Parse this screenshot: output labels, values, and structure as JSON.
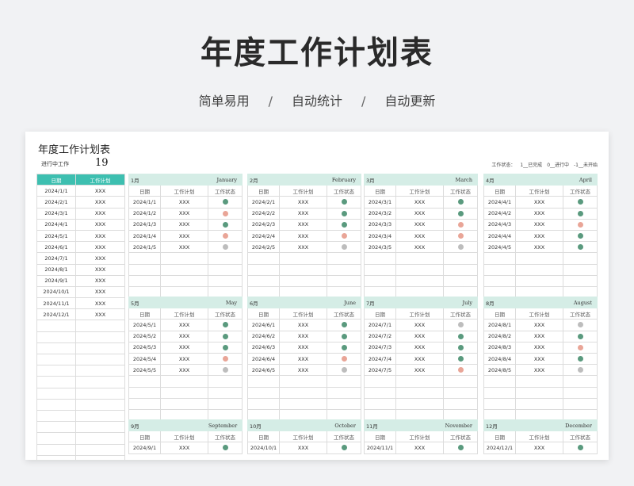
{
  "hero": {
    "title": "年度工作计划表",
    "sub1": "简单易用",
    "sub2": "自动统计",
    "sub3": "自动更新",
    "sep": "/"
  },
  "sheet": {
    "title": "年度工作计划表",
    "inprogress_label": "进行中工作",
    "inprogress_value": "19",
    "legend": {
      "label": "工作状态：",
      "done": "1__已完成",
      "doing": "0__进行中",
      "todo": "-1__未开始"
    }
  },
  "colors": {
    "done": "#5a9a7e",
    "doing": "#e9a597",
    "todo": "#bdbdbd",
    "accent": "#3dbfb0",
    "month_header": "#d5ede6"
  },
  "summary": {
    "headers": [
      "日期",
      "工作计划"
    ],
    "rows": [
      [
        "2024/1/1",
        "XXX"
      ],
      [
        "2024/2/1",
        "XXX"
      ],
      [
        "2024/3/1",
        "XXX"
      ],
      [
        "2024/4/1",
        "XXX"
      ],
      [
        "2024/5/1",
        "XXX"
      ],
      [
        "2024/6/1",
        "XXX"
      ],
      [
        "2024/7/1",
        "XXX"
      ],
      [
        "2024/8/1",
        "XXX"
      ],
      [
        "2024/9/1",
        "XXX"
      ],
      [
        "2024/10/1",
        "XXX"
      ],
      [
        "2024/11/1",
        "XXX"
      ],
      [
        "2024/12/1",
        "XXX"
      ]
    ]
  },
  "month_columns": [
    "日期",
    "工作计划",
    "工作状态"
  ],
  "months": [
    {
      "name": "1月",
      "en": "January",
      "rows": [
        [
          "2024/1/1",
          "XXX",
          "done"
        ],
        [
          "2024/1/2",
          "XXX",
          "doing"
        ],
        [
          "2024/1/3",
          "XXX",
          "done"
        ],
        [
          "2024/1/4",
          "XXX",
          "doing"
        ],
        [
          "2024/1/5",
          "XXX",
          "todo"
        ]
      ]
    },
    {
      "name": "2月",
      "en": "February",
      "rows": [
        [
          "2024/2/1",
          "XXX",
          "done"
        ],
        [
          "2024/2/2",
          "XXX",
          "done"
        ],
        [
          "2024/2/3",
          "XXX",
          "done"
        ],
        [
          "2024/2/4",
          "XXX",
          "doing"
        ],
        [
          "2024/2/5",
          "XXX",
          "todo"
        ]
      ]
    },
    {
      "name": "3月",
      "en": "March",
      "rows": [
        [
          "2024/3/1",
          "XXX",
          "done"
        ],
        [
          "2024/3/2",
          "XXX",
          "done"
        ],
        [
          "2024/3/3",
          "XXX",
          "doing"
        ],
        [
          "2024/3/4",
          "XXX",
          "doing"
        ],
        [
          "2024/3/5",
          "XXX",
          "todo"
        ]
      ]
    },
    {
      "name": "4月",
      "en": "April",
      "rows": [
        [
          "2024/4/1",
          "XXX",
          "done"
        ],
        [
          "2024/4/2",
          "XXX",
          "done"
        ],
        [
          "2024/4/3",
          "XXX",
          "doing"
        ],
        [
          "2024/4/4",
          "XXX",
          "done"
        ],
        [
          "2024/4/5",
          "XXX",
          "done"
        ]
      ]
    },
    {
      "name": "5月",
      "en": "May",
      "rows": [
        [
          "2024/5/1",
          "XXX",
          "done"
        ],
        [
          "2024/5/2",
          "XXX",
          "done"
        ],
        [
          "2024/5/3",
          "XXX",
          "done"
        ],
        [
          "2024/5/4",
          "XXX",
          "doing"
        ],
        [
          "2024/5/5",
          "XXX",
          "todo"
        ]
      ]
    },
    {
      "name": "6月",
      "en": "June",
      "rows": [
        [
          "2024/6/1",
          "XXX",
          "done"
        ],
        [
          "2024/6/2",
          "XXX",
          "done"
        ],
        [
          "2024/6/3",
          "XXX",
          "done"
        ],
        [
          "2024/6/4",
          "XXX",
          "doing"
        ],
        [
          "2024/6/5",
          "XXX",
          "todo"
        ]
      ]
    },
    {
      "name": "7月",
      "en": "July",
      "rows": [
        [
          "2024/7/1",
          "XXX",
          "todo"
        ],
        [
          "2024/7/2",
          "XXX",
          "done"
        ],
        [
          "2024/7/3",
          "XXX",
          "done"
        ],
        [
          "2024/7/4",
          "XXX",
          "done"
        ],
        [
          "2024/7/5",
          "XXX",
          "doing"
        ]
      ]
    },
    {
      "name": "8月",
      "en": "August",
      "rows": [
        [
          "2024/8/1",
          "XXX",
          "todo"
        ],
        [
          "2024/8/2",
          "XXX",
          "done"
        ],
        [
          "2024/8/3",
          "XXX",
          "doing"
        ],
        [
          "2024/8/4",
          "XXX",
          "done"
        ],
        [
          "2024/8/5",
          "XXX",
          "todo"
        ]
      ]
    },
    {
      "name": "9月",
      "en": "September",
      "rows": [
        [
          "2024/9/1",
          "XXX",
          "done"
        ]
      ]
    },
    {
      "name": "10月",
      "en": "October",
      "rows": [
        [
          "2024/10/1",
          "XXX",
          "done"
        ]
      ]
    },
    {
      "name": "11月",
      "en": "November",
      "rows": [
        [
          "2024/11/1",
          "XXX",
          "done"
        ]
      ]
    },
    {
      "name": "12月",
      "en": "December",
      "rows": [
        [
          "2024/12/1",
          "XXX",
          "done"
        ]
      ]
    }
  ]
}
